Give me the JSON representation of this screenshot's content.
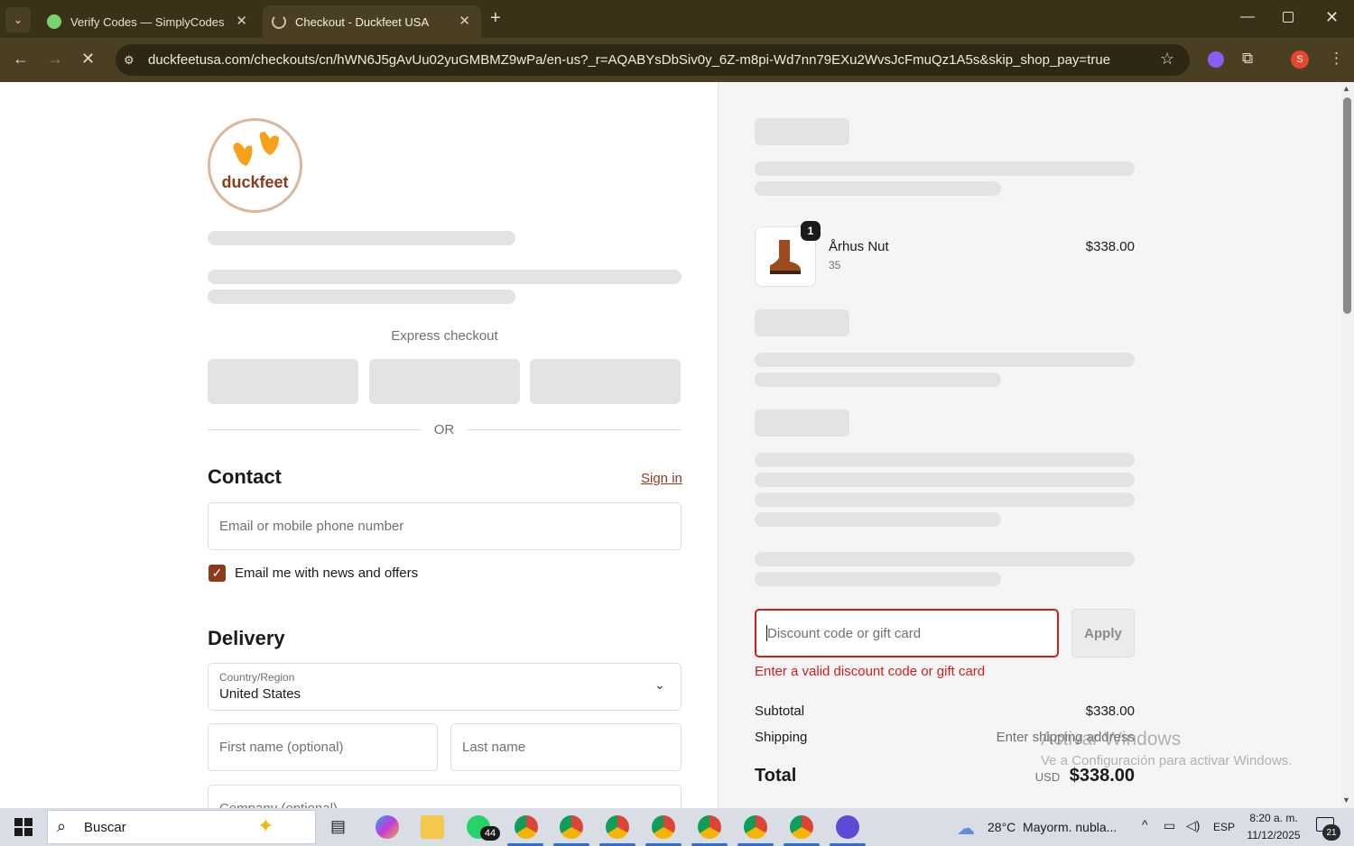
{
  "browser": {
    "tabs": [
      {
        "title": "Verify Codes — SimplyCodes",
        "active": false
      },
      {
        "title": "Checkout - Duckfeet USA",
        "active": true
      }
    ],
    "url": "duckfeetusa.com/checkouts/cn/hWN6J5gAvUu02yuGMBMZ9wPa/en-us?_r=AQABYsDbSiv0y_6Z-m8pi-Wd7nn79EXu2WvsJcFmuQz1A5s&skip_shop_pay=true",
    "profile_initial": "S"
  },
  "checkout": {
    "brand": "duckfeet",
    "express_checkout_label": "Express checkout",
    "or_label": "OR",
    "contact": {
      "heading": "Contact",
      "sign_in": "Sign in",
      "email_placeholder": "Email or mobile phone number",
      "newsletter_label": "Email me with news and offers",
      "newsletter_checked": true
    },
    "delivery": {
      "heading": "Delivery",
      "country_label": "Country/Region",
      "country_value": "United States",
      "first_name_placeholder": "First name (optional)",
      "last_name_placeholder": "Last name",
      "company_placeholder": "Company (optional)"
    }
  },
  "summary": {
    "item": {
      "name": "Århus Nut",
      "variant": "35",
      "quantity": "1",
      "price": "$338.00"
    },
    "discount_placeholder": "Discount code or gift card",
    "apply_label": "Apply",
    "discount_error": "Enter a valid discount code or gift card",
    "subtotal_label": "Subtotal",
    "subtotal_value": "$338.00",
    "shipping_label": "Shipping",
    "shipping_value": "Enter shipping address",
    "total_label": "Total",
    "total_currency": "USD",
    "total_value": "$338.00"
  },
  "watermark": {
    "title": "Activar Windows",
    "subtitle": "Ve a Configuración para activar Windows."
  },
  "taskbar": {
    "search_label": "Buscar",
    "whatsapp_badge": "44",
    "weather": "28°C  Mayorm. nubla...",
    "language": "ESP",
    "time": "8:20 a. m.",
    "date": "11/12/2025",
    "notifications": "21"
  },
  "colors": {
    "accent": "#8b3a1c",
    "error": "#d51c1c",
    "brand_orange": "#f5a11a"
  }
}
